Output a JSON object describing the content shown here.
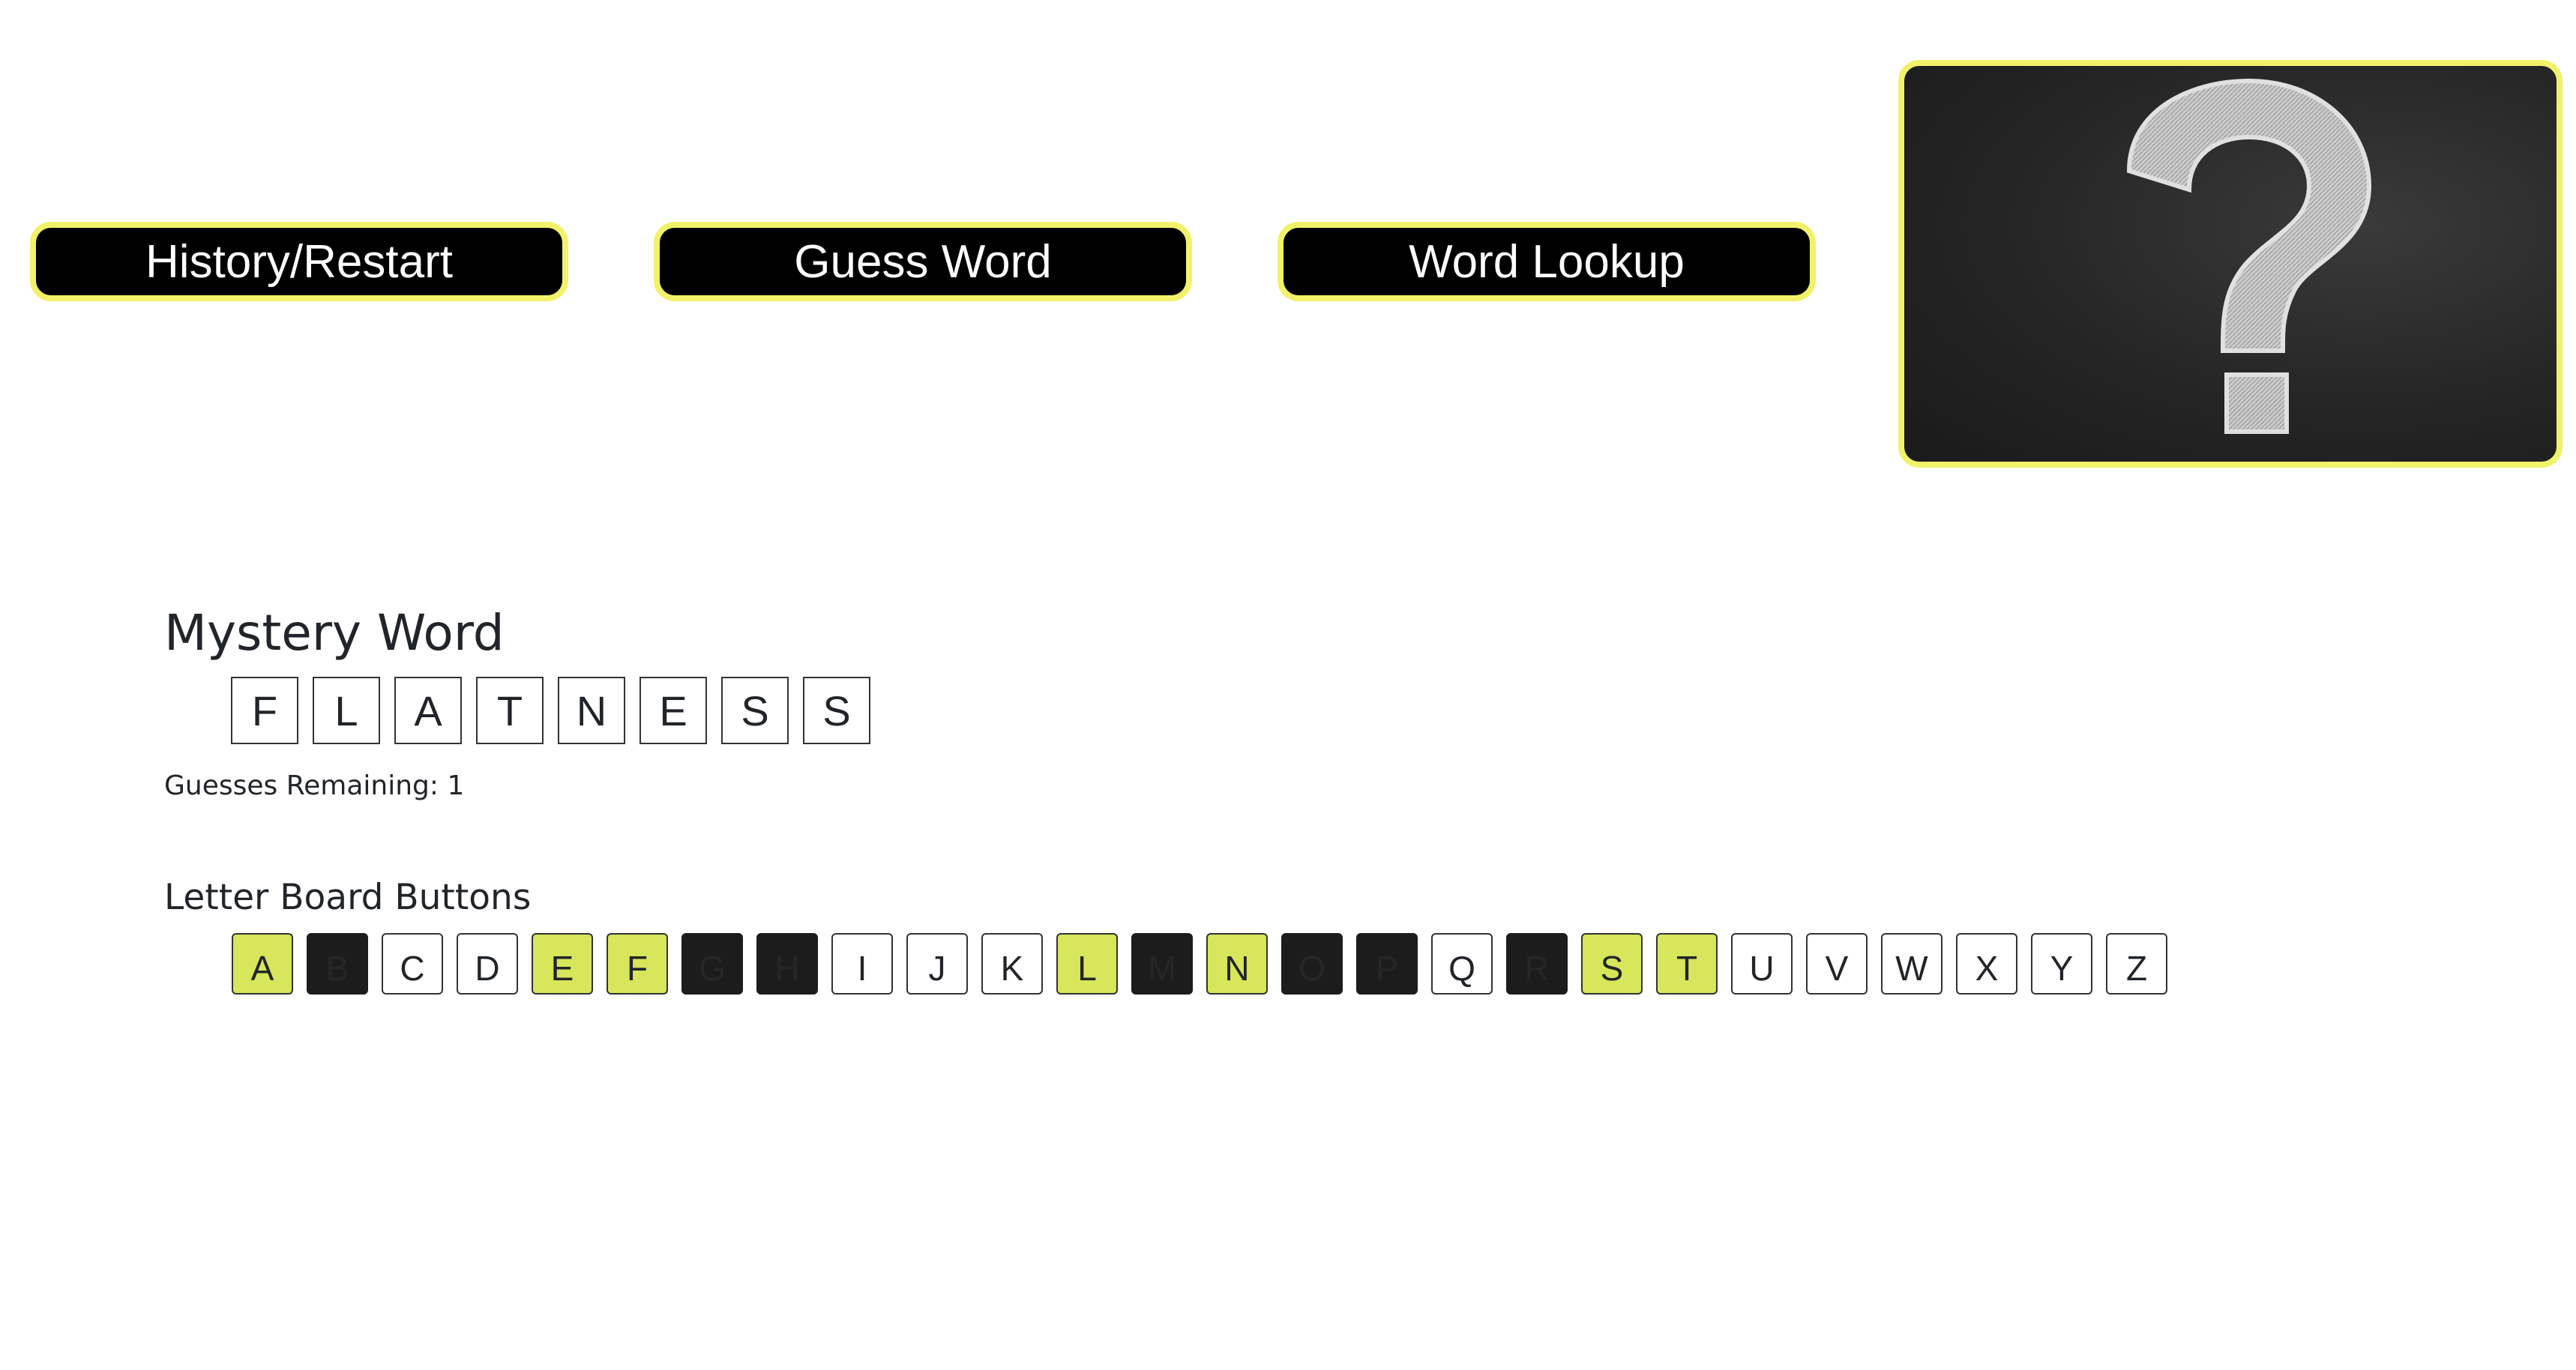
{
  "nav": {
    "history_label": "History/Restart",
    "guess_label": "Guess Word",
    "lookup_label": "Word Lookup"
  },
  "hero": {
    "icon": "chalk-question-mark-icon"
  },
  "mystery": {
    "title": "Mystery Word",
    "letters": [
      "F",
      "L",
      "A",
      "T",
      "N",
      "E",
      "S",
      "S"
    ],
    "guesses_remaining": "Guesses Remaining: 1"
  },
  "board": {
    "title": "Letter Board Buttons",
    "letters": [
      {
        "letter": "A",
        "state": "correct"
      },
      {
        "letter": "B",
        "state": "wrong"
      },
      {
        "letter": "C",
        "state": "unused"
      },
      {
        "letter": "D",
        "state": "unused"
      },
      {
        "letter": "E",
        "state": "correct"
      },
      {
        "letter": "F",
        "state": "correct"
      },
      {
        "letter": "G",
        "state": "wrong"
      },
      {
        "letter": "H",
        "state": "wrong"
      },
      {
        "letter": "I",
        "state": "unused"
      },
      {
        "letter": "J",
        "state": "unused"
      },
      {
        "letter": "K",
        "state": "unused"
      },
      {
        "letter": "L",
        "state": "correct"
      },
      {
        "letter": "M",
        "state": "wrong"
      },
      {
        "letter": "N",
        "state": "correct"
      },
      {
        "letter": "O",
        "state": "wrong"
      },
      {
        "letter": "P",
        "state": "wrong"
      },
      {
        "letter": "Q",
        "state": "unused"
      },
      {
        "letter": "R",
        "state": "wrong"
      },
      {
        "letter": "S",
        "state": "correct"
      },
      {
        "letter": "T",
        "state": "correct"
      },
      {
        "letter": "U",
        "state": "unused"
      },
      {
        "letter": "V",
        "state": "unused"
      },
      {
        "letter": "W",
        "state": "unused"
      },
      {
        "letter": "X",
        "state": "unused"
      },
      {
        "letter": "Y",
        "state": "unused"
      },
      {
        "letter": "Z",
        "state": "unused"
      }
    ]
  },
  "colors": {
    "accent_border": "#f2f26a",
    "correct_fill": "#d7e65a",
    "wrong_fill": "#1c1c1c",
    "button_fill": "#000000"
  }
}
